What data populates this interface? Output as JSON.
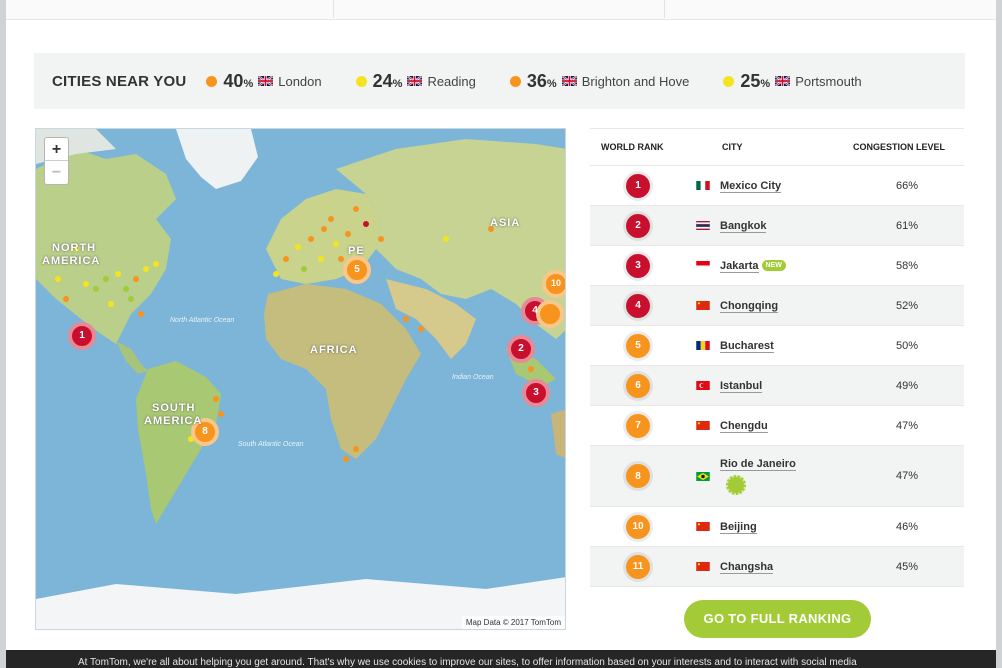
{
  "colors": {
    "red": "#c8102e",
    "orange": "#f7941d",
    "yellow": "#f4e31e",
    "green": "#a3cb38"
  },
  "cities_near": {
    "title": "CITIES NEAR YOU",
    "items": [
      {
        "value": "40",
        "unit": "%",
        "name": "London",
        "dot": "#f7941d"
      },
      {
        "value": "24",
        "unit": "%",
        "name": "Reading",
        "dot": "#f4e31e"
      },
      {
        "value": "36",
        "unit": "%",
        "name": "Brighton and Hove",
        "dot": "#f7941d"
      },
      {
        "value": "25",
        "unit": "%",
        "name": "Portsmouth",
        "dot": "#f4e31e"
      }
    ]
  },
  "map": {
    "zoom_in": "+",
    "zoom_out": "−",
    "attribution": "Map Data © 2017 TomTom",
    "labels": {
      "north_america_1": "NORTH",
      "north_america_2": "AMERICA",
      "south_america_1": "SOUTH",
      "south_america_2": "AMERICA",
      "africa": "AFRICA",
      "asia": "ASIA",
      "europe": "PE",
      "north_atlantic": "North Atlantic Ocean",
      "south_atlantic": "South Atlantic Ocean",
      "indian": "Indian Ocean"
    },
    "markers": [
      "1",
      "2",
      "3",
      "4",
      "5",
      "8",
      "10"
    ]
  },
  "ranking": {
    "headers": {
      "rank": "WORLD RANK",
      "city": "CITY",
      "congestion": "CONGESTION LEVEL"
    },
    "rows": [
      {
        "rank": "1",
        "city": "Mexico City",
        "level": "66%",
        "color": "#c8102e",
        "flag": "mexico"
      },
      {
        "rank": "2",
        "city": "Bangkok",
        "level": "61%",
        "color": "#c8102e",
        "flag": "thailand"
      },
      {
        "rank": "3",
        "city": "Jakarta",
        "level": "58%",
        "color": "#c8102e",
        "flag": "indonesia",
        "new": "NEW"
      },
      {
        "rank": "4",
        "city": "Chongqing",
        "level": "52%",
        "color": "#c8102e",
        "flag": "china"
      },
      {
        "rank": "5",
        "city": "Bucharest",
        "level": "50%",
        "color": "#f7941d",
        "flag": "romania"
      },
      {
        "rank": "6",
        "city": "Istanbul",
        "level": "49%",
        "color": "#f7941d",
        "flag": "turkey"
      },
      {
        "rank": "7",
        "city": "Chengdu",
        "level": "47%",
        "color": "#f7941d",
        "flag": "china"
      },
      {
        "rank": "8",
        "city": "Rio de Janeiro",
        "level": "47%",
        "color": "#f7941d",
        "flag": "brazil",
        "medal": true
      },
      {
        "rank": "10",
        "city": "Beijing",
        "level": "46%",
        "color": "#f7941d",
        "flag": "china"
      },
      {
        "rank": "11",
        "city": "Changsha",
        "level": "45%",
        "color": "#f7941d",
        "flag": "china"
      }
    ],
    "button": "GO TO FULL RANKING"
  },
  "cookie_text": "At TomTom, we're all about helping you get around. That's why we use cookies to improve our sites, to offer information based on your interests and to interact with social media"
}
